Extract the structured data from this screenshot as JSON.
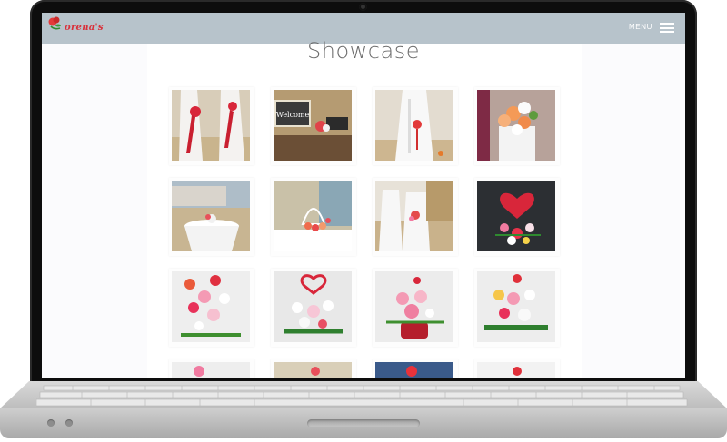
{
  "nav": {
    "brand": "orena's",
    "menu_label": "MENU",
    "menu_icon": "hamburger-icon"
  },
  "page": {
    "title": "Showcase"
  },
  "gallery": {
    "items": [
      {
        "name": "Chair sashes with red roses on beach"
      },
      {
        "name": "Welcome sign with flowers"
      },
      {
        "name": "White chair with red flower"
      },
      {
        "name": "Orange and white bridal bouquet"
      },
      {
        "name": "Beach table with centerpiece"
      },
      {
        "name": "Birdcage centerpiece"
      },
      {
        "name": "Beach chairs with flower accent"
      },
      {
        "name": "Heart balloon arrangement"
      },
      {
        "name": "Mixed pink red arrangement"
      },
      {
        "name": "Heart balloon lilies arrangement"
      },
      {
        "name": "Pink carnation arrangement"
      },
      {
        "name": "Red roses lilies arrangement"
      },
      {
        "name": "Partial arrangement 1"
      },
      {
        "name": "Partial arrangement 2"
      },
      {
        "name": "Partial arrangement 3"
      },
      {
        "name": "Partial arrangement 4"
      }
    ]
  },
  "colors": {
    "nav_bg": "#b7c3cb",
    "brand_red": "#d9303a",
    "title_gray": "#6b6b6b"
  }
}
